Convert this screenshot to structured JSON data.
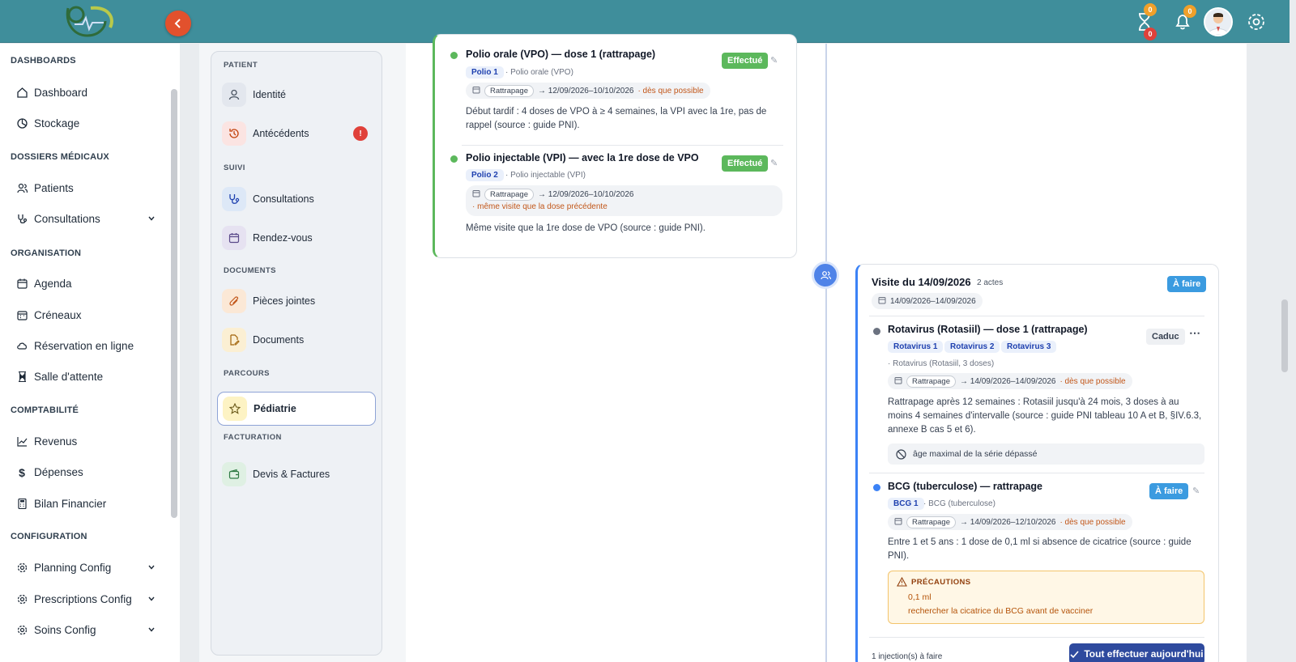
{
  "topbar": {
    "hourglass_badge_top": "0",
    "hourglass_badge_bottom": "0",
    "bell_badge": "0"
  },
  "sidebar": {
    "sections": [
      {
        "title": "DASHBOARDS",
        "items": [
          {
            "label": "Dashboard",
            "icon": "home-icon"
          },
          {
            "label": "Stockage",
            "icon": "chart-pie-icon"
          }
        ]
      },
      {
        "title": "DOSSIERS MÉDICAUX",
        "items": [
          {
            "label": "Patients",
            "icon": "users-icon"
          },
          {
            "label": "Consultations",
            "icon": "stethoscope-icon"
          }
        ]
      },
      {
        "title": "ORGANISATION",
        "items": [
          {
            "label": "Agenda",
            "icon": "calendar-icon"
          },
          {
            "label": "Créneaux",
            "icon": "calendar-slots-icon"
          },
          {
            "label": "Réservation en ligne",
            "icon": "cloud-icon"
          },
          {
            "label": "Salle d'attente",
            "icon": "hourglass-icon"
          }
        ]
      },
      {
        "title": "COMPTABILITÉ",
        "items": [
          {
            "label": "Revenus",
            "icon": "line-chart-icon"
          },
          {
            "label": "Dépenses",
            "icon": "dollar-icon"
          },
          {
            "label": "Bilan Financier",
            "icon": "calculator-icon"
          }
        ]
      },
      {
        "title": "CONFIGURATION",
        "items": [
          {
            "label": "Planning Config",
            "icon": "gear-icon"
          },
          {
            "label": "Prescriptions Config",
            "icon": "gear-icon"
          },
          {
            "label": "Soins Config",
            "icon": "gear-icon"
          }
        ]
      }
    ]
  },
  "patient_nav": {
    "sections": {
      "patient": "PATIENT",
      "suivi": "SUIVI",
      "documents": "DOCUMENTS",
      "parcours": "PARCOURS",
      "facturation": "FACTURATION"
    },
    "items": {
      "identite": "Identité",
      "antecedents": "Antécédents",
      "antecedents_alert": "!",
      "consultations": "Consultations",
      "rendez_vous": "Rendez-vous",
      "pieces_jointes": "Pièces jointes",
      "documents": "Documents",
      "pediatrie": "Pédiatrie",
      "devis": "Devis & Factures"
    }
  },
  "previous_visit": {
    "acts": [
      {
        "title": "Polio orale (VPO) — dose 1 (rattrapage)",
        "status": "Effectué",
        "tag": "Polio 1",
        "vaccine": "· Polio orale (VPO)",
        "window_type": "Rattrapage",
        "window": "→ 12/09/2026–10/10/2026",
        "window_note": "· dès que possible",
        "description": "Début tardif : 4 doses de VPO à ≥ 4 semaines, la VPI avec la 1re, pas de rappel (source : guide PNI)."
      },
      {
        "title": "Polio injectable (VPI) — avec la 1re dose de VPO",
        "status": "Effectué",
        "tag": "Polio 2",
        "vaccine": "· Polio injectable (VPI)",
        "window_type": "Rattrapage",
        "window": "→ 12/09/2026–10/10/2026",
        "window_note": "· même visite que la dose précédente",
        "description": "Même visite que la 1re dose de VPO (source : guide PNI)."
      }
    ]
  },
  "visit": {
    "title": "Visite du 14/09/2026",
    "count": "2 actes",
    "status": "À faire",
    "date_range": "14/09/2026–14/09/2026",
    "acts": [
      {
        "title": "Rotavirus (Rotasiil) — dose 1 (rattrapage)",
        "status": "Caduc",
        "tags": [
          "Rotavirus 1",
          "Rotavirus 2",
          "Rotavirus 3"
        ],
        "vaccine": "· Rotavirus (Rotasiil, 3 doses)",
        "window_type": "Rattrapage",
        "window": "→ 14/09/2026–14/09/2026",
        "window_note": "· dès que possible",
        "description": "Rattrapage après 12 semaines : Rotasiil jusqu'à 24 mois, 3 doses à au moins 4 semaines d'intervalle (source : guide PNI tableau 10 A et B, §IV.6.3, annexe B cas 5 et 6).",
        "warning": "âge maximal de la série dépassé"
      },
      {
        "title": "BCG (tuberculose) — rattrapage",
        "status": "À faire",
        "tag": "BCG 1",
        "vaccine": "· BCG (tuberculose)",
        "window_type": "Rattrapage",
        "window": "→ 14/09/2026–12/10/2026",
        "window_note": "· dès que possible",
        "description": "Entre 1 et 5 ans : 1 dose de 0,1 ml si absence de cicatrice (source : guide PNI).",
        "precautions_title": "PRÉCAUTIONS",
        "precautions": [
          "0,1 ml",
          "rechercher la cicatrice du BCG avant de vacciner"
        ]
      }
    ],
    "footer_count": "1 injection(s) à faire",
    "footer_button": "Tout effectuer aujourd'hui"
  },
  "colors": {
    "topbar": "#3f8e9b",
    "collapse": "#e2512d",
    "success": "#5cb85c",
    "todo": "#3b9be0",
    "primary": "#2e4a9e"
  }
}
